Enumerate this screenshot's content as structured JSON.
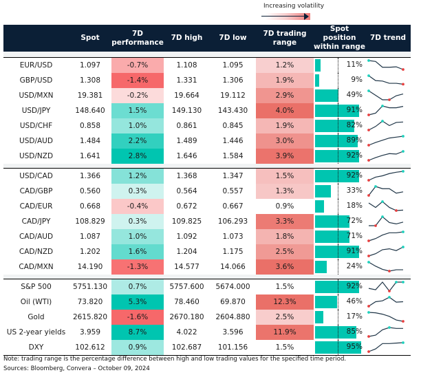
{
  "legend": {
    "label": "Increasing volatility"
  },
  "headers": {
    "name": "",
    "spot": "Spot",
    "perf_1": "7D",
    "perf_2": "performance",
    "high": "7D high",
    "low": "7D low",
    "range_1": "7D trading",
    "range_2": "range",
    "pos_1": "Spot position",
    "pos_2": "within range",
    "trend": "7D trend"
  },
  "colors": {
    "header_bg": "#0b1f36",
    "bar": "#00c5b0",
    "spark_line": "#1e3446",
    "spark_high": "#1fd1bd",
    "spark_low": "#e84040"
  },
  "sections": [
    {
      "rows": [
        {
          "name": "EUR/USD",
          "spot": "1.097",
          "perf": "-0.7%",
          "perf_val": -0.7,
          "high": "1.108",
          "low": "1.095",
          "range": "1.2%",
          "range_val": 1.2,
          "pos": "11%",
          "pos_val": 0.11,
          "trend": [
            1.0,
            0.9,
            0.25,
            0.25,
            0.3,
            0.0
          ],
          "hi_idx": 0,
          "lo_idx": 5
        },
        {
          "name": "GBP/USD",
          "spot": "1.308",
          "perf": "-1.4%",
          "perf_val": -1.4,
          "high": "1.331",
          "low": "1.306",
          "range": "1.9%",
          "range_val": 1.9,
          "pos": "9%",
          "pos_val": 0.09,
          "trend": [
            1.0,
            0.45,
            0.4,
            0.15,
            0.15,
            0.05
          ],
          "hi_idx": 0,
          "lo_idx": 5
        },
        {
          "name": "USD/MXN",
          "spot": "19.381",
          "perf": "-0.2%",
          "perf_val": -0.2,
          "high": "19.664",
          "low": "19.112",
          "range": "2.9%",
          "range_val": 2.9,
          "pos": "49%",
          "pos_val": 0.49,
          "trend": [
            1.0,
            0.5,
            0.0,
            0.0,
            0.45,
            0.65
          ],
          "hi_idx": 0,
          "lo_idx": 3
        },
        {
          "name": "USD/JPY",
          "spot": "148.640",
          "perf": "1.5%",
          "perf_val": 1.5,
          "high": "149.130",
          "low": "143.430",
          "range": "4.0%",
          "range_val": 4.0,
          "pos": "91%",
          "pos_val": 0.91,
          "trend": [
            0.0,
            0.2,
            1.0,
            0.8,
            0.8,
            0.95
          ],
          "hi_idx": 2,
          "lo_idx": 0
        },
        {
          "name": "USD/CHF",
          "spot": "0.858",
          "perf": "1.0%",
          "perf_val": 1.0,
          "high": "0.861",
          "low": "0.845",
          "range": "1.9%",
          "range_val": 1.9,
          "pos": "82%",
          "pos_val": 0.82,
          "trend": [
            0.0,
            0.4,
            1.0,
            0.5,
            0.85,
            0.9
          ],
          "hi_idx": 2,
          "lo_idx": 0
        },
        {
          "name": "USD/AUD",
          "spot": "1.484",
          "perf": "2.2%",
          "perf_val": 2.2,
          "high": "1.489",
          "low": "1.446",
          "range": "3.0%",
          "range_val": 3.0,
          "pos": "89%",
          "pos_val": 0.89,
          "trend": [
            0.0,
            0.3,
            0.55,
            0.8,
            0.9,
            1.0
          ],
          "hi_idx": 5,
          "lo_idx": 0
        },
        {
          "name": "USD/NZD",
          "spot": "1.641",
          "perf": "2.8%",
          "perf_val": 2.8,
          "high": "1.646",
          "low": "1.584",
          "range": "3.9%",
          "range_val": 3.9,
          "pos": "92%",
          "pos_val": 0.92,
          "trend": [
            0.0,
            0.3,
            0.55,
            0.75,
            0.7,
            1.0
          ],
          "hi_idx": 5,
          "lo_idx": 0
        }
      ]
    },
    {
      "rows": [
        {
          "name": "USD/CAD",
          "spot": "1.366",
          "perf": "1.2%",
          "perf_val": 1.2,
          "high": "1.368",
          "low": "1.347",
          "range": "1.5%",
          "range_val": 1.5,
          "pos": "92%",
          "pos_val": 0.92,
          "trend": [
            0.0,
            0.35,
            0.5,
            0.75,
            0.9,
            1.0
          ],
          "hi_idx": 5,
          "lo_idx": 0
        },
        {
          "name": "CAD/GBP",
          "spot": "0.560",
          "perf": "0.3%",
          "perf_val": 0.3,
          "high": "0.564",
          "low": "0.557",
          "range": "1.3%",
          "range_val": 1.3,
          "pos": "33%",
          "pos_val": 0.33,
          "trend": [
            0.0,
            1.0,
            0.75,
            0.75,
            0.25,
            0.4
          ],
          "hi_idx": 1,
          "lo_idx": 0
        },
        {
          "name": "CAD/EUR",
          "spot": "0.668",
          "perf": "-0.4%",
          "perf_val": -0.4,
          "high": "0.672",
          "low": "0.667",
          "range": "0.9%",
          "range_val": 0.9,
          "pos": "18%",
          "pos_val": 0.18,
          "trend": [
            0.85,
            0.35,
            1.0,
            0.35,
            0.0,
            0.05
          ],
          "hi_idx": 2,
          "lo_idx": 4
        },
        {
          "name": "CAD/JPY",
          "spot": "108.829",
          "perf": "0.3%",
          "perf_val": 0.3,
          "high": "109.825",
          "low": "106.293",
          "range": "3.3%",
          "range_val": 3.3,
          "pos": "72%",
          "pos_val": 0.72,
          "trend": [
            0.0,
            0.0,
            1.0,
            0.35,
            0.2,
            0.4
          ],
          "hi_idx": 2,
          "lo_idx": 1
        },
        {
          "name": "CAD/AUD",
          "spot": "1.087",
          "perf": "1.0%",
          "perf_val": 1.0,
          "high": "1.092",
          "low": "1.073",
          "range": "1.8%",
          "range_val": 1.8,
          "pos": "71%",
          "pos_val": 0.71,
          "trend": [
            0.0,
            0.25,
            0.65,
            0.9,
            0.9,
            1.0
          ],
          "hi_idx": 5,
          "lo_idx": 0
        },
        {
          "name": "CAD/NZD",
          "spot": "1.202",
          "perf": "1.6%",
          "perf_val": 1.6,
          "high": "1.204",
          "low": "1.175",
          "range": "2.5%",
          "range_val": 2.5,
          "pos": "91%",
          "pos_val": 0.91,
          "trend": [
            0.0,
            0.25,
            0.7,
            0.8,
            0.6,
            1.0
          ],
          "hi_idx": 5,
          "lo_idx": 0
        },
        {
          "name": "CAD/MXN",
          "spot": "14.190",
          "perf": "-1.3%",
          "perf_val": -1.3,
          "high": "14.577",
          "low": "14.066",
          "range": "3.6%",
          "range_val": 3.6,
          "pos": "24%",
          "pos_val": 0.24,
          "trend": [
            1.0,
            0.55,
            0.2,
            0.0,
            0.15,
            0.15
          ],
          "hi_idx": 0,
          "lo_idx": 3
        }
      ]
    },
    {
      "rows": [
        {
          "name": "S&P 500",
          "spot": "5751.130",
          "perf": "0.7%",
          "perf_val": 0.7,
          "high": "5757.600",
          "low": "5674.000",
          "range": "1.5%",
          "range_val": 1.5,
          "pos": "92%",
          "pos_val": 0.92,
          "trend": [
            0.3,
            0.15,
            1.0,
            0.0,
            1.0,
            1.0
          ],
          "hi_idx": 4,
          "lo_idx": 3,
          "hi_idx2": 5
        },
        {
          "name": "Oil (WTI)",
          "spot": "73.820",
          "perf": "5.3%",
          "perf_val": 5.3,
          "high": "78.460",
          "low": "69.870",
          "range": "12.3%",
          "range_val": 12.3,
          "pos": "46%",
          "pos_val": 0.46,
          "trend": [
            0.0,
            0.5,
            0.6,
            1.0,
            0.45,
            0.5
          ],
          "hi_idx": 3,
          "lo_idx": 0
        },
        {
          "name": "Gold",
          "spot": "2615.820",
          "perf": "-1.6%",
          "perf_val": -1.6,
          "high": "2670.180",
          "low": "2604.880",
          "range": "2.5%",
          "range_val": 2.5,
          "pos": "17%",
          "pos_val": 0.17,
          "trend": [
            1.0,
            0.95,
            0.8,
            0.55,
            0.15,
            0.0
          ],
          "hi_idx": 0,
          "lo_idx": 5
        },
        {
          "name": "US 2-year yields",
          "spot": "3.959",
          "perf": "8.7%",
          "perf_val": 8.7,
          "high": "4.022",
          "low": "3.596",
          "range": "11.9%",
          "range_val": 11.9,
          "pos": "85%",
          "pos_val": 0.85,
          "trend": [
            0.0,
            0.15,
            0.75,
            1.0,
            0.9,
            0.9
          ],
          "hi_idx": 3,
          "lo_idx": 0
        },
        {
          "name": "DXY",
          "spot": "102.612",
          "perf": "0.9%",
          "perf_val": 0.9,
          "high": "102.687",
          "low": "101.156",
          "range": "1.5%",
          "range_val": 1.5,
          "pos": "95%",
          "pos_val": 0.95,
          "trend": [
            0.0,
            0.3,
            0.9,
            0.9,
            0.95,
            1.0
          ],
          "hi_idx": 5,
          "lo_idx": 0
        }
      ]
    }
  ],
  "footer": {
    "note": "Note: trading range is the percentage difference between high and low trading values for the specified time period.",
    "sources": "Sources: Bloomberg, Convera – October 09, 2024"
  }
}
